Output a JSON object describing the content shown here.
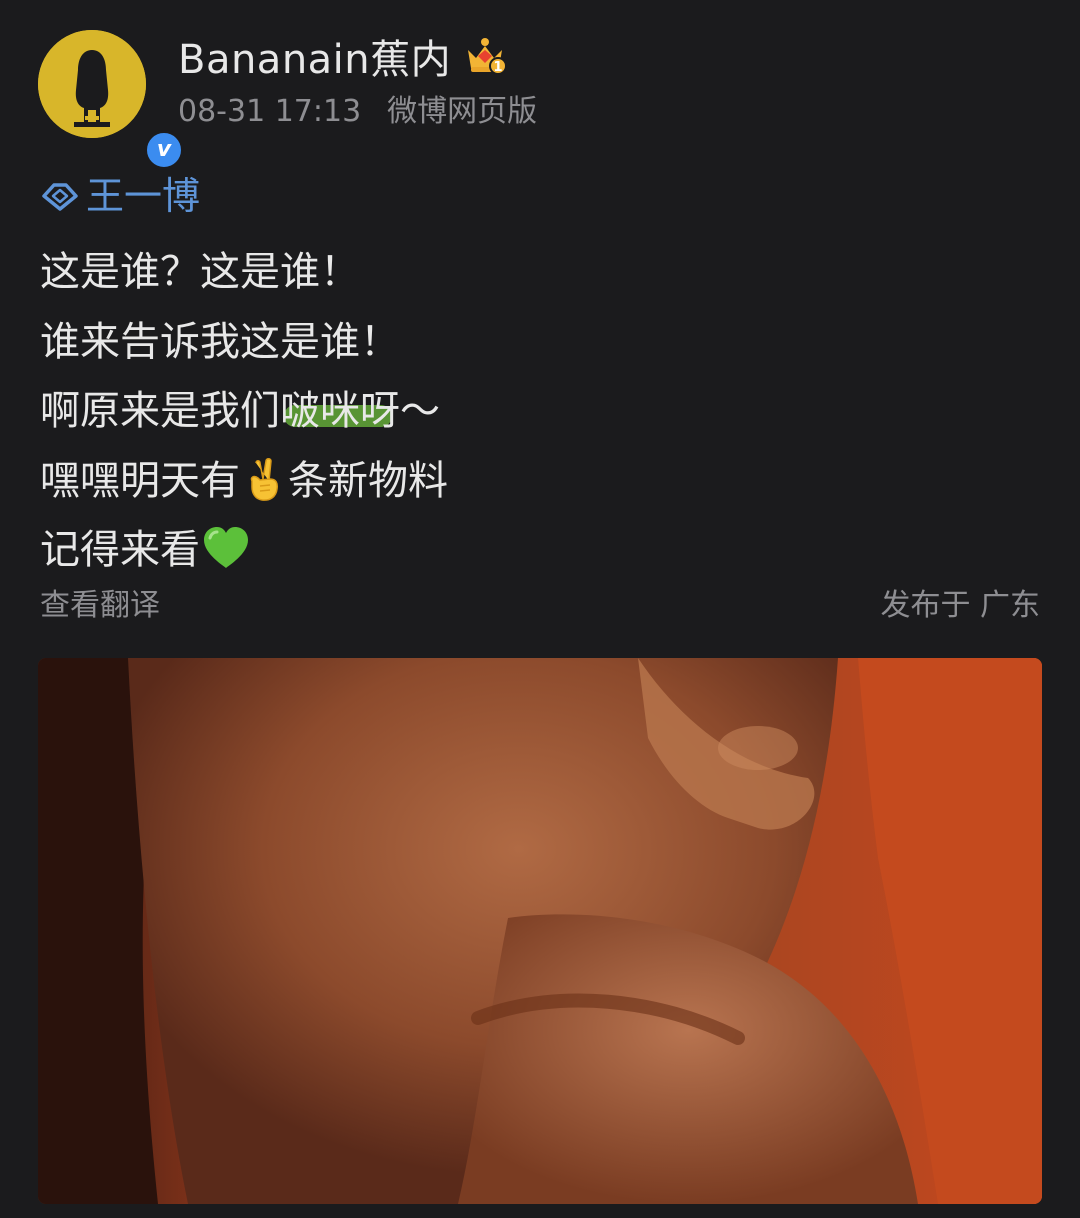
{
  "post": {
    "username": "Bananain蕉内",
    "timestamp": "08-31 17:13",
    "source": "微博网页版",
    "verified_mark": "v",
    "crown_level": "1",
    "topic": "王一博",
    "lines": {
      "l1": "这是谁？这是谁！",
      "l2": "谁来告诉我这是谁！",
      "l3_before": "啊原来是我们",
      "l3_highlight": "啵咪呀",
      "l3_after": "～",
      "l4_before": "嘿嘿明天有",
      "l4_after": "条新物料",
      "l5": "记得来看"
    },
    "translate_label": "查看翻译",
    "location": "发布于 广东"
  },
  "icons": {
    "avatar": "bananain-logo-avatar",
    "verified": "verified-badge-icon",
    "crown": "crown-icon",
    "topic": "diamond-topic-icon",
    "emoji_1": "victory-hand-emoji",
    "emoji_2": "green-heart-emoji"
  },
  "colors": {
    "background": "#1b1b1d",
    "text": "#e8e8e8",
    "muted": "#8e8e92",
    "topic": "#5e94d8",
    "highlight": "#6ebe3c",
    "verified": "#3b8cf0",
    "avatar": "#d8b62a"
  }
}
